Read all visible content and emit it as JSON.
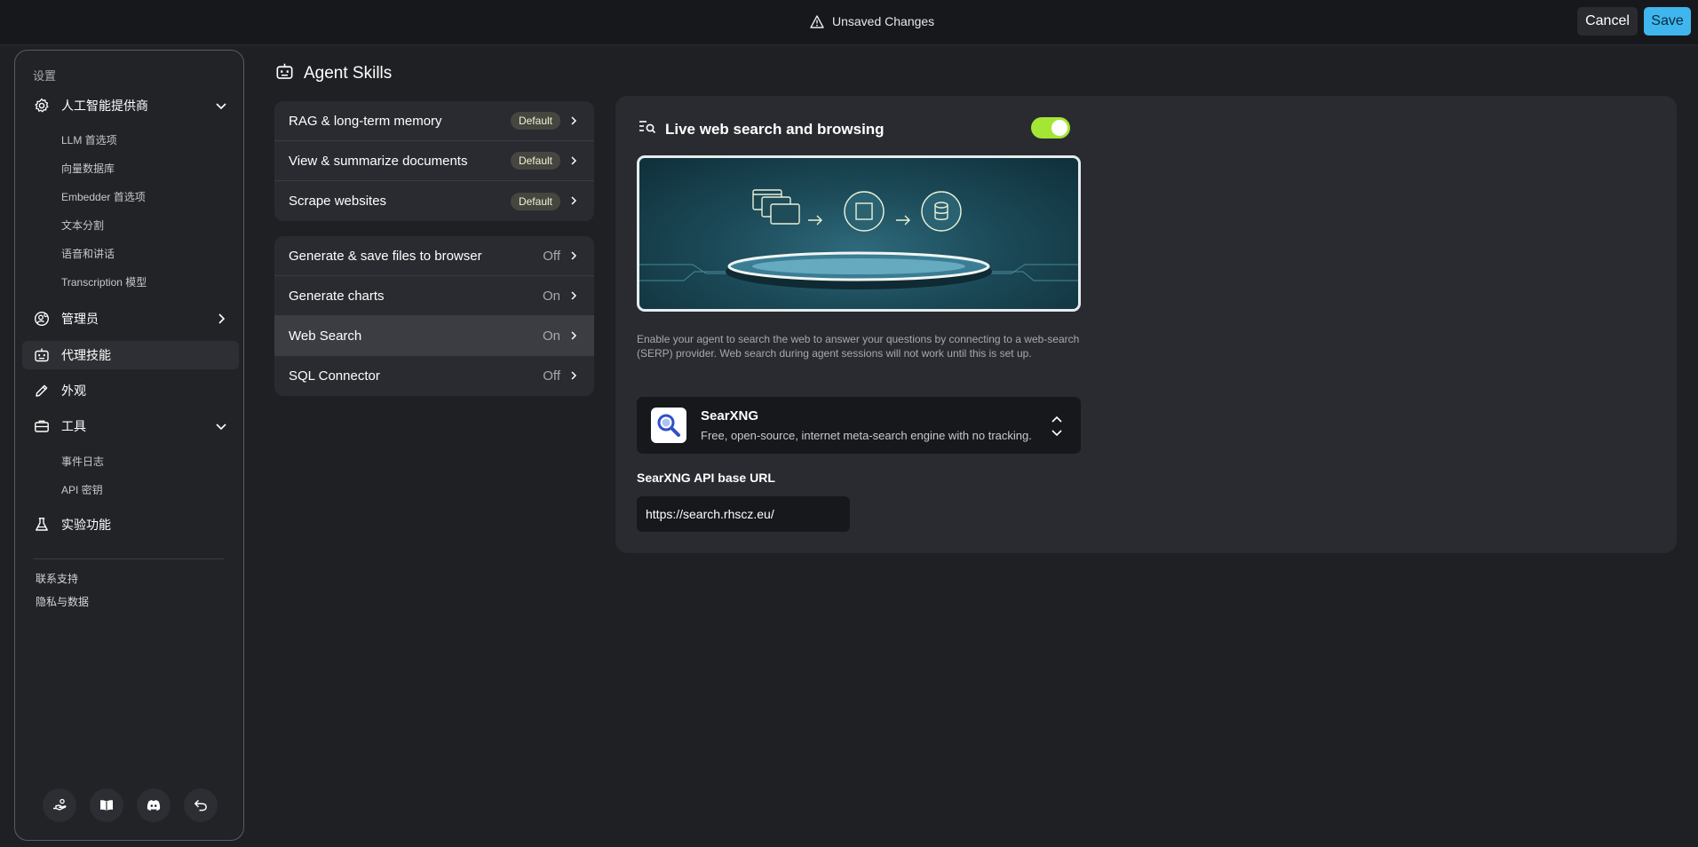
{
  "topbar": {
    "unsaved_label": "Unsaved Changes",
    "cancel_label": "Cancel",
    "save_label": "Save",
    "save_color": "#3fb6ee"
  },
  "sidebar": {
    "title": "设置",
    "sections": {
      "ai_providers": {
        "label": "人工智能提供商",
        "icon": "gear-icon",
        "expanded": true,
        "items": [
          "LLM 首选项",
          "向量数据库",
          "Embedder 首选项",
          "文本分割",
          "语音和讲话",
          "Transcription 模型"
        ]
      },
      "admin": {
        "label": "管理员",
        "icon": "user-gear-icon",
        "expanded": false
      },
      "agent_skills": {
        "label": "代理技能",
        "icon": "robot-icon",
        "active": true
      },
      "appearance": {
        "label": "外观",
        "icon": "pencil-icon"
      },
      "tools": {
        "label": "工具",
        "icon": "briefcase-icon",
        "expanded": true,
        "items": [
          "事件日志",
          "API 密钥"
        ]
      },
      "experimental": {
        "label": "实验功能",
        "icon": "flask-icon"
      }
    },
    "footer_links": [
      "联系支持",
      "隐私与数据"
    ],
    "footer_icons": [
      "support-hand-icon",
      "book-icon",
      "discord-icon",
      "back-arrow-icon"
    ]
  },
  "main": {
    "title": "Agent Skills",
    "title_icon": "robot-icon",
    "default_skills": [
      {
        "name": "RAG & long-term memory",
        "badge": "Default"
      },
      {
        "name": "View & summarize documents",
        "badge": "Default"
      },
      {
        "name": "Scrape websites",
        "badge": "Default"
      }
    ],
    "configurable_skills": [
      {
        "name": "Generate & save files to browser",
        "state": "Off"
      },
      {
        "name": "Generate charts",
        "state": "On"
      },
      {
        "name": "Web Search",
        "state": "On",
        "selected": true
      },
      {
        "name": "SQL Connector",
        "state": "Off"
      }
    ]
  },
  "detail": {
    "title": "Live web search and browsing",
    "title_icon": "search-list-icon",
    "enabled": true,
    "toggle_color": "#a3e635",
    "description": "Enable your agent to search the web to answer your questions by connecting to a web-search (SERP) provider. Web search during agent sessions will not work until this is set up.",
    "provider": {
      "name": "SearXNG",
      "description": "Free, open-source, internet meta-search engine with no tracking.",
      "icon": "magnifier-logo-icon"
    },
    "field": {
      "label": "SearXNG API base URL",
      "value": "https://search.rhscz.eu/"
    }
  }
}
